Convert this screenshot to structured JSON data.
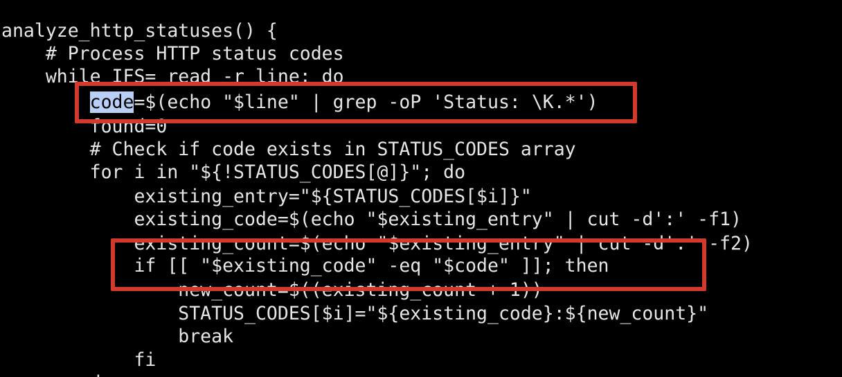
{
  "editor": {
    "lines": [
      "analyze_http_statuses() {",
      "    # Process HTTP status codes",
      "    while IFS= read -r line; do",
      "        code=$(echo \"$line\" | grep -oP 'Status: \\K.*')",
      "        found=0",
      "        # Check if code exists in STATUS_CODES array",
      "        for i in \"${!STATUS_CODES[@]}\"; do",
      "            existing_entry=\"${STATUS_CODES[$i]}\"",
      "            existing_code=$(echo \"$existing_entry\" | cut -d':' -f1)",
      "            existing_count=$(echo \"$existing_entry\" | cut -d':' -f2)",
      "            if [[ \"$existing_code\" -eq \"$code\" ]]; then",
      "                new_count=$((existing_count + 1))",
      "                STATUS_CODES[$i]=\"${existing_code}:${new_count}\"",
      "                break",
      "            fi",
      "        done"
    ],
    "line3_indent": "        ",
    "line3_selected": "code",
    "line3_rest": "=$(echo \"$line\" | grep -oP 'Status: \\K.*')"
  },
  "colors": {
    "background": "#000000",
    "text": "#e6e6e6",
    "selection": "#b9cff5",
    "annotation": "#d23a2e"
  }
}
